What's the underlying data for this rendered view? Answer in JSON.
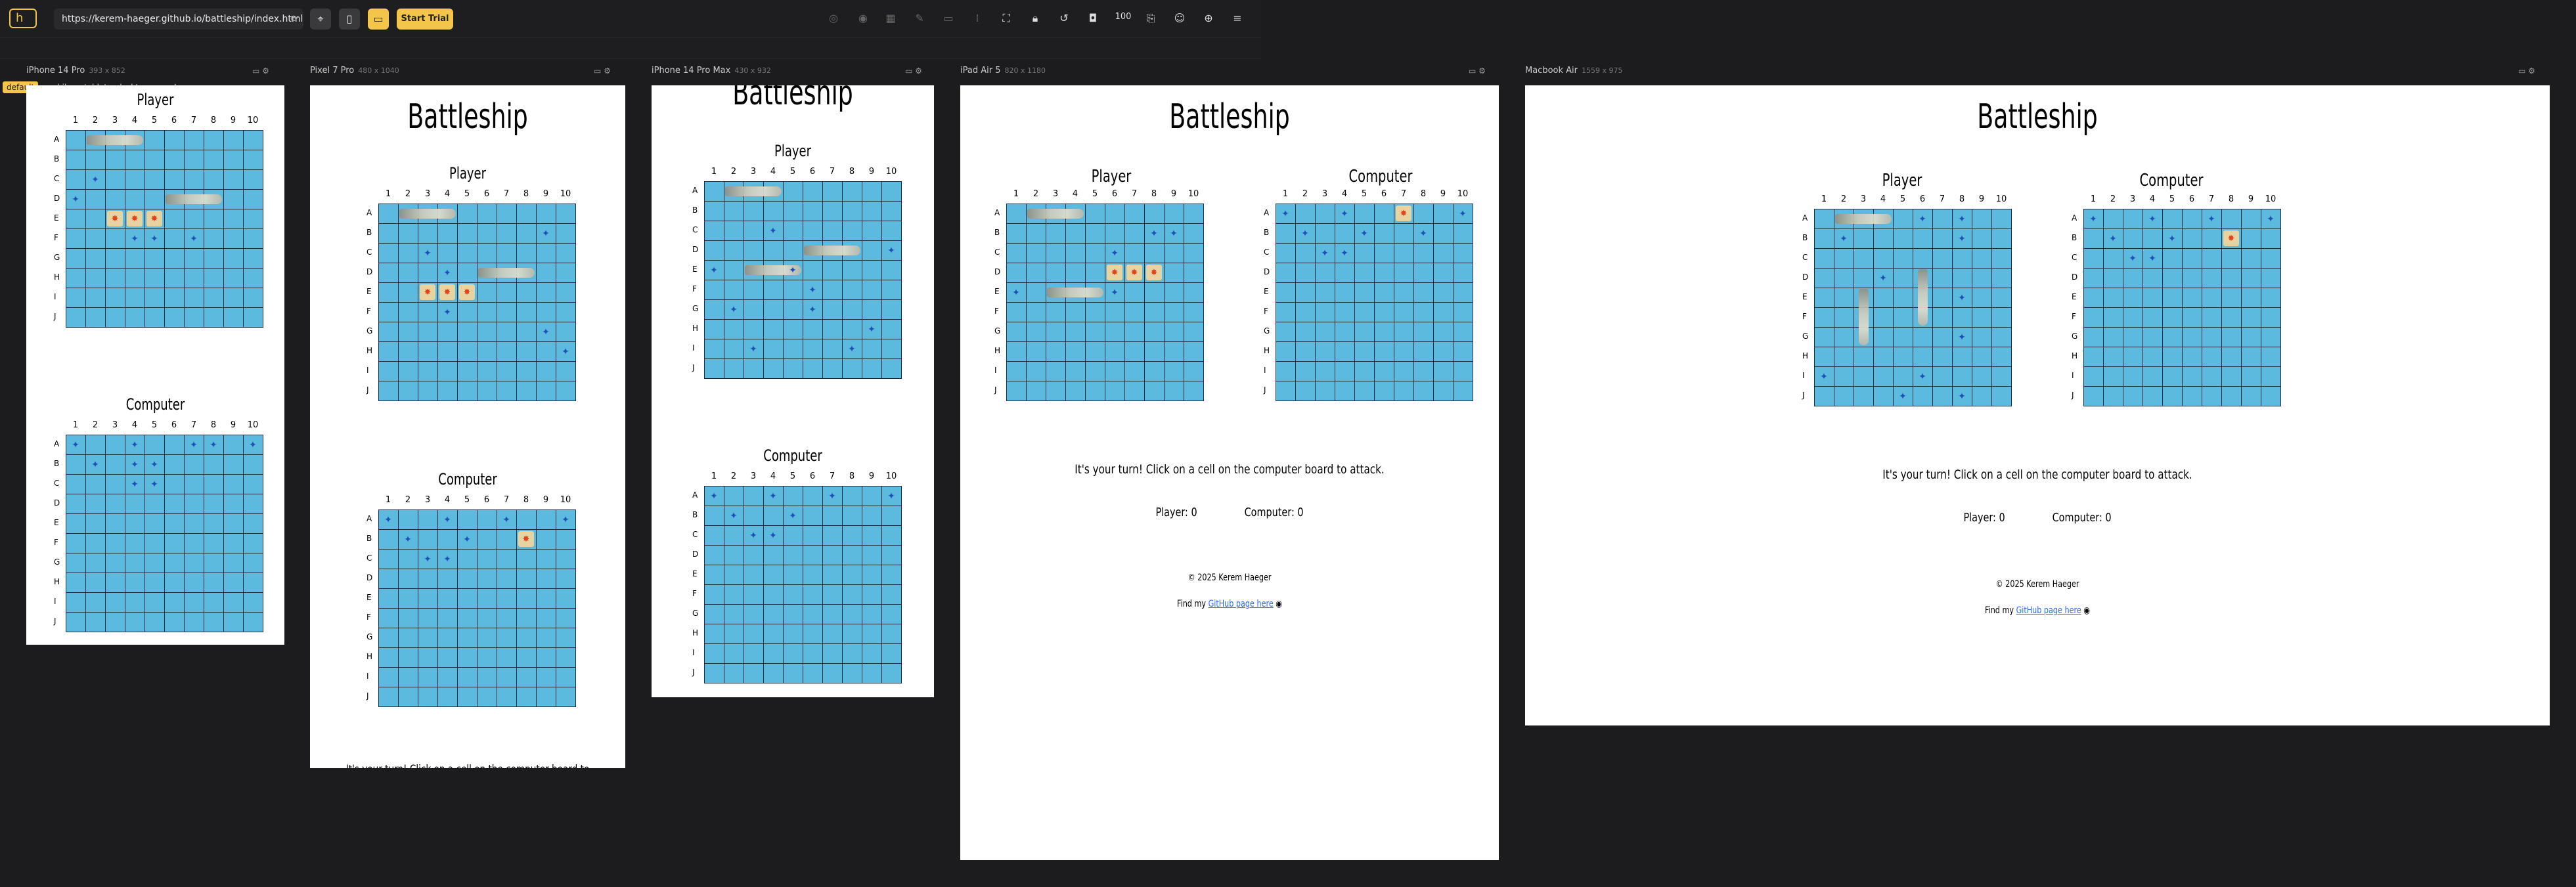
{
  "browser": {
    "url": "https://kerem-haeger.github.io/battleship/index.html",
    "reload_icon": "reload-icon",
    "start_trial": "Start Trial",
    "zoom": "100",
    "tabs": [
      "default",
      "mobile",
      "tablet",
      "desktop"
    ],
    "add_tab": "+"
  },
  "devices": [
    {
      "name": "iPhone 14 Pro",
      "size": "393 x 852"
    },
    {
      "name": "Pixel 7 Pro",
      "size": "480 x 1040"
    },
    {
      "name": "iPhone 14 Pro Max",
      "size": "430 x 932"
    },
    {
      "name": "iPad Air 5",
      "size": "820 x 1180"
    },
    {
      "name": "Macbook Air",
      "size": "1559 x 975"
    }
  ],
  "game": {
    "title": "Battleship",
    "player_label": "Player",
    "computer_label": "Computer",
    "columns": [
      "1",
      "2",
      "3",
      "4",
      "5",
      "6",
      "7",
      "8",
      "9",
      "10"
    ],
    "rows": [
      "A",
      "B",
      "C",
      "D",
      "E",
      "F",
      "G",
      "H",
      "I",
      "J"
    ],
    "message": "It's your turn! Click on a cell on the computer board to attack.",
    "player_score": "Player: 0",
    "computer_score": "Computer: 0",
    "copyright": "© 2025 Kerem Haeger",
    "footer_prefix": "Find my ",
    "footer_link": "GitHub page here"
  },
  "boards": {
    "iphone14pro": {
      "player": {
        "misses": [
          [
            2,
            1
          ],
          [
            3,
            0
          ],
          [
            4,
            2
          ],
          [
            5,
            3
          ],
          [
            5,
            6
          ],
          [
            5,
            4
          ]
        ],
        "hits": [
          [
            4,
            2
          ],
          [
            4,
            3
          ],
          [
            4,
            4
          ]
        ],
        "ships": [
          {
            "r": 0,
            "c": 1,
            "len": 3,
            "dir": "h"
          },
          {
            "r": 3,
            "c": 5,
            "len": 3,
            "dir": "h"
          }
        ]
      },
      "computer": {
        "misses": [
          [
            0,
            0
          ],
          [
            0,
            3
          ],
          [
            0,
            6
          ],
          [
            0,
            9
          ],
          [
            1,
            1
          ],
          [
            1,
            3
          ],
          [
            1,
            4
          ],
          [
            2,
            3
          ],
          [
            2,
            4
          ],
          [
            0,
            7
          ]
        ],
        "hits": [],
        "ships": []
      }
    },
    "pixel7pro": {
      "player": {
        "misses": [
          [
            2,
            2
          ],
          [
            3,
            3
          ],
          [
            5,
            3
          ],
          [
            1,
            8
          ],
          [
            7,
            9
          ],
          [
            6,
            8
          ]
        ],
        "hits": [
          [
            4,
            2
          ],
          [
            4,
            3
          ],
          [
            4,
            4
          ]
        ],
        "ships": [
          {
            "r": 0,
            "c": 1,
            "len": 3,
            "dir": "h"
          },
          {
            "r": 3,
            "c": 5,
            "len": 3,
            "dir": "h"
          }
        ]
      },
      "computer": {
        "misses": [
          [
            0,
            0
          ],
          [
            0,
            3
          ],
          [
            0,
            6
          ],
          [
            0,
            9
          ],
          [
            1,
            1
          ],
          [
            1,
            4
          ],
          [
            2,
            2
          ],
          [
            2,
            3
          ]
        ],
        "hits": [
          [
            1,
            7
          ]
        ],
        "ships": []
      }
    },
    "iphone14promax": {
      "player": {
        "misses": [
          [
            3,
            9
          ],
          [
            4,
            0
          ],
          [
            4,
            4
          ],
          [
            5,
            5
          ],
          [
            6,
            1
          ],
          [
            6,
            5
          ],
          [
            7,
            8
          ],
          [
            8,
            2
          ],
          [
            8,
            7
          ],
          [
            2,
            3
          ]
        ],
        "hits": [],
        "ships": [
          {
            "r": 0,
            "c": 1,
            "len": 3,
            "dir": "h"
          },
          {
            "r": 3,
            "c": 5,
            "len": 3,
            "dir": "h"
          },
          {
            "r": 4,
            "c": 2,
            "len": 3,
            "dir": "h"
          }
        ]
      },
      "computer": {
        "misses": [
          [
            0,
            0
          ],
          [
            0,
            3
          ],
          [
            0,
            6
          ],
          [
            0,
            9
          ],
          [
            1,
            1
          ],
          [
            1,
            4
          ],
          [
            2,
            2
          ],
          [
            2,
            3
          ]
        ],
        "hits": [],
        "ships": []
      }
    },
    "ipadair5": {
      "player": {
        "misses": [
          [
            1,
            7
          ],
          [
            1,
            8
          ],
          [
            2,
            5
          ],
          [
            4,
            0
          ],
          [
            4,
            5
          ],
          [
            3,
            7
          ]
        ],
        "hits": [
          [
            3,
            5
          ],
          [
            3,
            6
          ],
          [
            3,
            7
          ]
        ],
        "ships": [
          {
            "r": 0,
            "c": 1,
            "len": 3,
            "dir": "h"
          },
          {
            "r": 4,
            "c": 2,
            "len": 3,
            "dir": "h"
          }
        ]
      },
      "computer": {
        "misses": [
          [
            0,
            0
          ],
          [
            0,
            3
          ],
          [
            0,
            9
          ],
          [
            1,
            1
          ],
          [
            1,
            4
          ],
          [
            1,
            7
          ],
          [
            2,
            2
          ],
          [
            2,
            3
          ]
        ],
        "hits": [
          [
            0,
            6
          ]
        ],
        "ships": []
      }
    },
    "macbookair": {
      "player": {
        "misses": [
          [
            1,
            1
          ],
          [
            0,
            5
          ],
          [
            0,
            7
          ],
          [
            1,
            7
          ],
          [
            3,
            3
          ],
          [
            4,
            7
          ],
          [
            6,
            7
          ],
          [
            8,
            0
          ],
          [
            8,
            5
          ],
          [
            9,
            4
          ],
          [
            9,
            7
          ]
        ],
        "hits": [],
        "ships": [
          {
            "r": 0,
            "c": 1,
            "len": 3,
            "dir": "h"
          },
          {
            "r": 4,
            "c": 2,
            "len": 3,
            "dir": "v"
          },
          {
            "r": 3,
            "c": 5,
            "len": 3,
            "dir": "v"
          }
        ]
      },
      "computer": {
        "misses": [
          [
            0,
            0
          ],
          [
            0,
            3
          ],
          [
            0,
            6
          ],
          [
            0,
            9
          ],
          [
            1,
            1
          ],
          [
            1,
            4
          ],
          [
            2,
            2
          ],
          [
            2,
            3
          ]
        ],
        "hits": [
          [
            1,
            7
          ]
        ],
        "ships": []
      }
    }
  }
}
